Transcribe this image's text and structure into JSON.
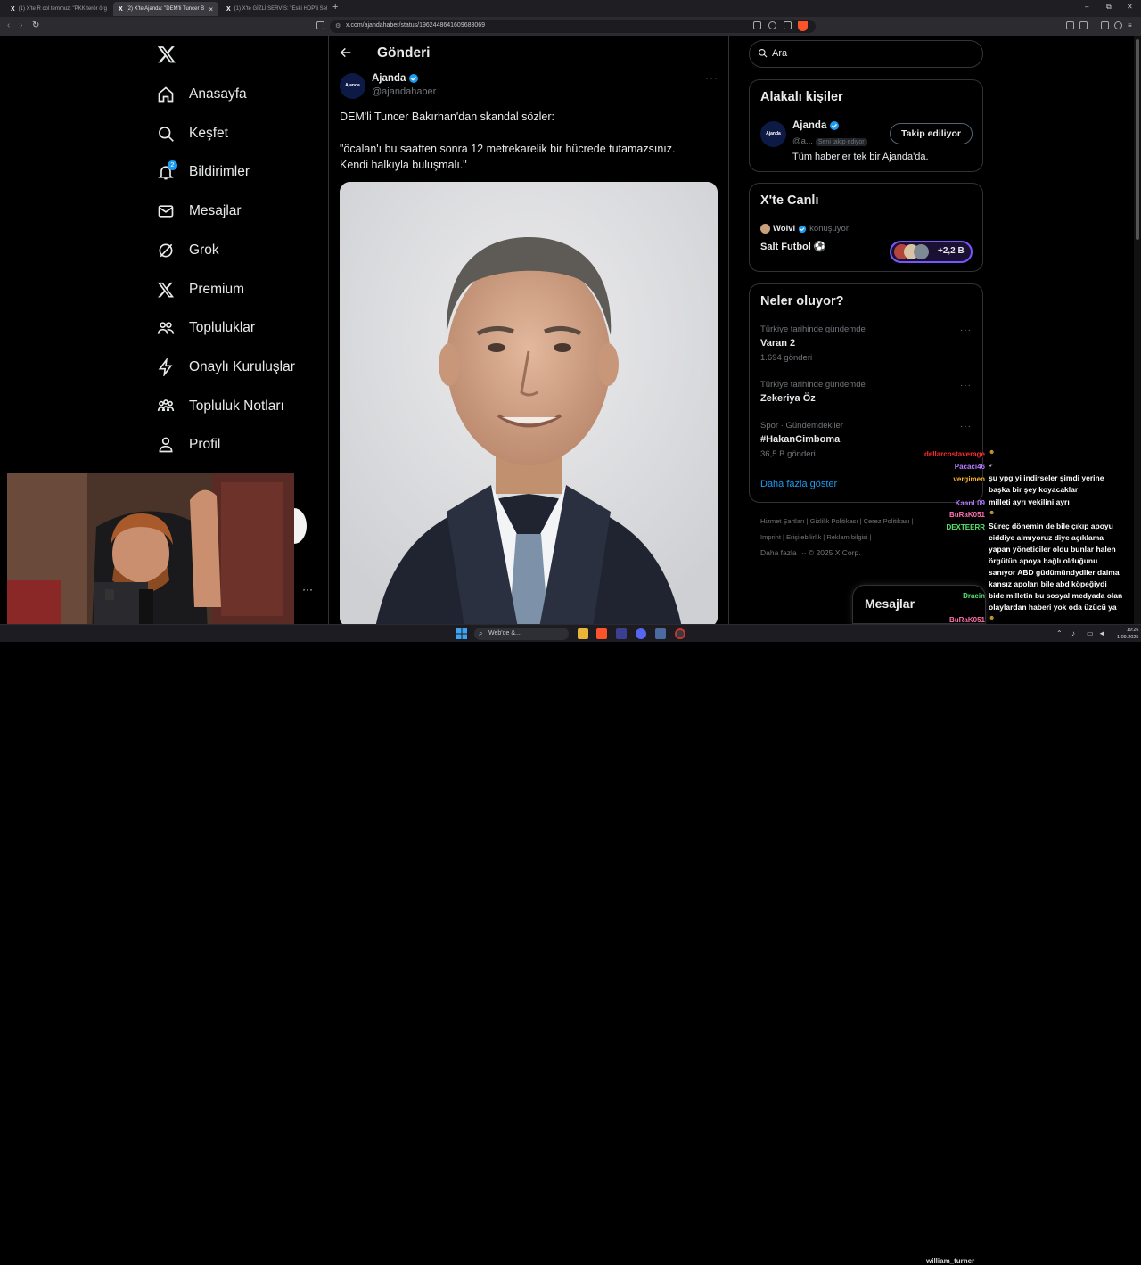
{
  "browser": {
    "tabs": [
      {
        "label": "(1) X'te R col temmuz: \"PKK terör örg"
      },
      {
        "label": "(2) X'te Ajanda: \"DEM'li Tuncer B"
      },
      {
        "label": "(1) X'te GİZLİ SERVİS: \"Eski HDP'li Sel"
      }
    ],
    "url": "x.com/ajandahaber/status/1962448641609683069",
    "new_tab": "+",
    "minimize": "–",
    "maximize": "⧉",
    "close": "✕"
  },
  "sidebar": {
    "items": [
      {
        "label": "Anasayfa",
        "icon": "home-icon"
      },
      {
        "label": "Keşfet",
        "icon": "search-icon"
      },
      {
        "label": "Bildirimler",
        "icon": "bell-icon",
        "badge": "2"
      },
      {
        "label": "Mesajlar",
        "icon": "mail-icon"
      },
      {
        "label": "Grok",
        "icon": "grok-icon"
      },
      {
        "label": "Premium",
        "icon": "x-icon"
      },
      {
        "label": "Topluluklar",
        "icon": "communities-icon"
      },
      {
        "label": "Onaylı Kuruluşlar",
        "icon": "lightning-icon"
      },
      {
        "label": "Topluluk Notları",
        "icon": "notes-icon"
      },
      {
        "label": "Profil",
        "icon": "profile-icon"
      }
    ],
    "more": "···"
  },
  "post": {
    "header_title": "Gönderi",
    "author_name": "Ajanda",
    "author_handle": "@ajandahaber",
    "avatar_text": "Ajanda",
    "line1": "DEM'li Tuncer Bakırhan'dan skandal sözler:",
    "line2": "\"öcalan'ı bu saatten sonra 12 metrekarelik bir hücrede tutamazsınız.",
    "line3": "Kendi halkıyla buluşmalı.\""
  },
  "right": {
    "search_placeholder": "Ara",
    "related": {
      "title": "Alakalı kişiler",
      "name": "Ajanda",
      "handle": "@a...",
      "follows_you": "Seni takip ediyor",
      "button": "Takip ediliyor",
      "bio": "Tüm haberler tek bir Ajanda'da."
    },
    "live": {
      "title": "X'te Canlı",
      "host": "Wolvi",
      "status": "konuşuyor",
      "topic": "Salt Futbol ⚽",
      "count": "+2,2 B"
    },
    "trends": {
      "title": "Neler oluyor?",
      "items": [
        {
          "meta": "Türkiye tarihinde gündemde",
          "name": "Varan 2",
          "count": "1.694 gönderi"
        },
        {
          "meta": "Türkiye tarihinde gündemde",
          "name": "Zekeriya Öz",
          "count": ""
        },
        {
          "meta": "Spor · Gündemdekiler",
          "name": "#HakanCimboma",
          "count": "36,5 B gönderi"
        }
      ],
      "show_more": "Daha fazla göster"
    },
    "footer": {
      "line1": "Hizmet Şartları  |  Gizlilik Politikası  |  Çerez Politikası  |",
      "line2": "Imprint  |  Erişilebilirlik  |  Reklam bilgisi  |",
      "line3": "Daha fazla ···   © 2025 X Corp."
    },
    "messages_drawer": "Mesajlar"
  },
  "chat": {
    "names": [
      {
        "name": "dellarcostaverage",
        "color": "#ff2d2d"
      },
      {
        "name": "Pacaci46",
        "color": "#b57bff"
      },
      {
        "name": "vergimen",
        "color": "#ffb52e"
      },
      {
        "name": "KaanL09",
        "color": "#b57bff"
      },
      {
        "name": "BuRaK051",
        "color": "#ff6fae"
      },
      {
        "name": "DEXTEERR",
        "color": "#59e36b"
      },
      {
        "name": "Draein",
        "color": "#59e36b"
      },
      {
        "name": "BuRaK051",
        "color": "#ff6fae"
      }
    ],
    "messages": [
      {
        "text": "şu ypg yi indirseler şimdi yerine"
      },
      {
        "text": "başka bir şey koyacaklar"
      },
      {
        "text": "milleti ayrı vekilini ayrı"
      },
      {
        "text": "Süreç dönemin de bile çıkıp apoyu"
      },
      {
        "text": "ciddiye almıyoruz diye açıklama"
      },
      {
        "text": "yapan yöneticiler oldu bunlar halen"
      },
      {
        "text": "örgütün apoya bağlı olduğunu"
      },
      {
        "text": "sanıyor ABD güdümündydiler daima"
      },
      {
        "text": "kansız apoları bile abd köpeğiydi"
      },
      {
        "text": "bide milletin bu sosyal medyada olan"
      },
      {
        "text": "olaylardan haberi yok oda üzücü ya"
      }
    ],
    "streamer": "william_turner"
  },
  "taskbar": {
    "search": "Web'de &...",
    "time": "19:26",
    "date": "1.09.2025"
  },
  "colors": {
    "accent": "#1d9bf0",
    "bg": "#000000",
    "border": "#2f3336",
    "muted": "#71767b"
  }
}
